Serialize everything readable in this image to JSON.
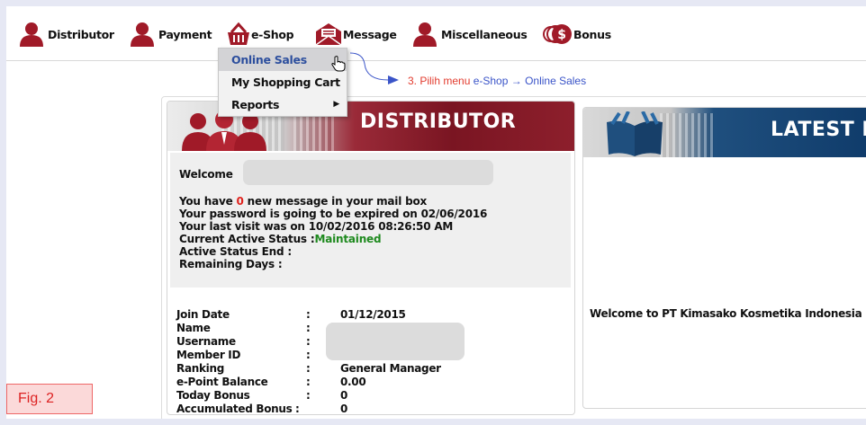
{
  "nav": {
    "items": [
      {
        "label": "Distributor",
        "icon": "person-icon"
      },
      {
        "label": "Payment",
        "icon": "person-icon"
      },
      {
        "label": "e-Shop",
        "icon": "shopping-basket-icon"
      },
      {
        "label": "Message",
        "icon": "envelope-icon"
      },
      {
        "label": "Miscellaneous",
        "icon": "person-icon"
      },
      {
        "label": "Bonus",
        "icon": "dollar-coin-icon"
      }
    ]
  },
  "dropdown": {
    "items": [
      {
        "label": "Online Sales",
        "state": "hover"
      },
      {
        "label": "My Shopping Cart"
      },
      {
        "label": "Reports",
        "submenu": "▶"
      }
    ]
  },
  "annotation": {
    "prefix": "3. Pilih menu ",
    "highlight": "e-Shop → Online Sales"
  },
  "distributor": {
    "title": "DISTRIBUTOR",
    "welcome_label": "Welcome",
    "msg_prefix": "You have ",
    "msg_count": "0",
    "msg_suffix": " new message in your mail box",
    "password_line": "Your password is going to be expired on 02/06/2016",
    "last_visit_line": "Your last visit was on 10/02/2016 08:26:50 AM",
    "status_label": "Current Active Status :",
    "status_value": "Maintained",
    "status_end_label": "Active Status End :",
    "remaining_label": "Remaining Days :",
    "info": [
      {
        "label": "Join Date",
        "value": "01/12/2015"
      },
      {
        "label": "Name",
        "value": ""
      },
      {
        "label": "Username",
        "value": ""
      },
      {
        "label": "Member ID",
        "value": ""
      },
      {
        "label": "Ranking",
        "value": "General Manager"
      },
      {
        "label": "e-Point Balance",
        "value": "0.00"
      },
      {
        "label": "Today Bonus",
        "value": "0"
      },
      {
        "label": "Accumulated Bonus",
        "value": "0"
      }
    ],
    "colon": ":"
  },
  "news": {
    "title": "LATEST N",
    "text": "Welcome to PT Kimasako Kosmetika Indonesia"
  },
  "figure_label": "Fig. 2",
  "colors": {
    "icon_red": "#a01a28",
    "accent_blue": "#3a54c8",
    "status_green": "#1f8a1f"
  }
}
